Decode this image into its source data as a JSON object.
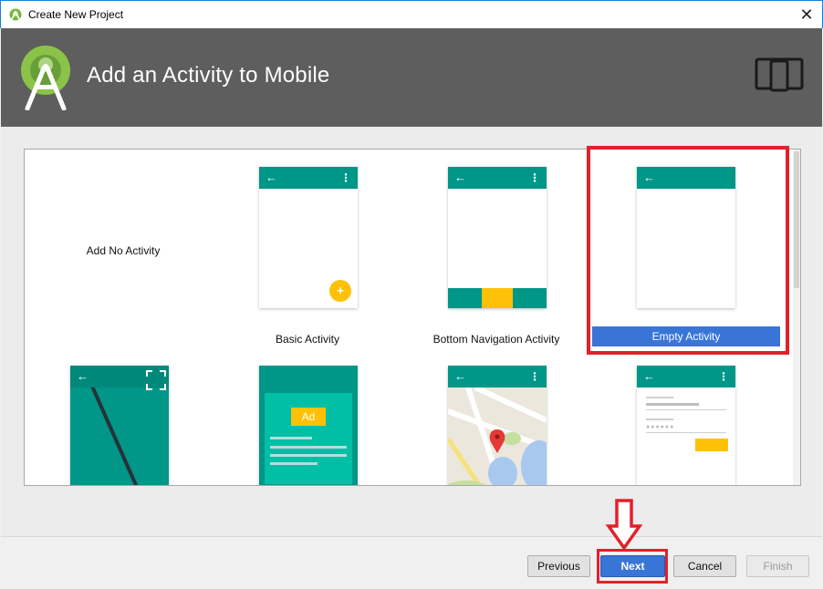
{
  "window": {
    "title": "Create New Project",
    "close_glyph": "✕"
  },
  "header": {
    "heading": "Add an Activity to Mobile",
    "logo_icon": "android-studio-logo-icon",
    "device_icon": "phone-tablet-icon"
  },
  "gallery": {
    "tiles": [
      {
        "label": "Add No Activity"
      },
      {
        "label": "Basic Activity"
      },
      {
        "label": "Bottom Navigation Activity"
      },
      {
        "label": "Empty Activity",
        "selected": true
      },
      {
        "label": ""
      },
      {
        "label": ""
      },
      {
        "label": ""
      },
      {
        "label": ""
      }
    ],
    "ad_text": "Ad",
    "fab_glyph": "+",
    "back_glyph": "←",
    "menu_glyph": "⋮"
  },
  "footer": {
    "previous_label": "Previous",
    "next_label": "Next",
    "cancel_label": "Cancel",
    "finish_label": "Finish"
  },
  "colors": {
    "accent": "#3875d7",
    "teal": "#009688",
    "amber": "#ffc107",
    "annotation_red": "#e3202a",
    "header_bg": "#5e5e5e"
  }
}
